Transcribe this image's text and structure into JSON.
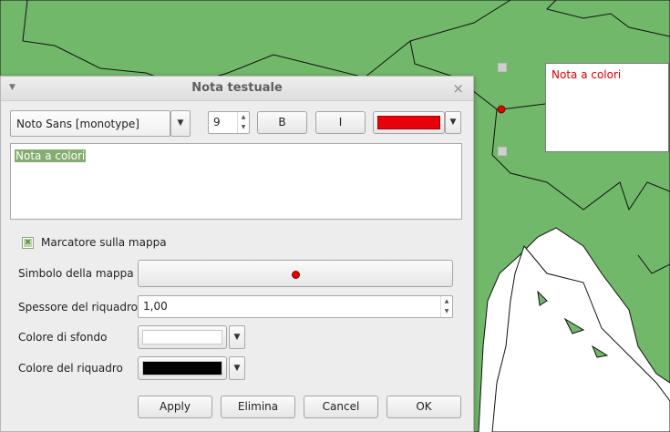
{
  "map": {
    "annotation_text": "Nota a colori",
    "land_color": "#72b86a",
    "background_color": "#ffffff",
    "marker_color": "#e00000"
  },
  "dialog": {
    "title": "Nota testuale",
    "menu_icon": "triangle-down-icon",
    "close_icon": "close-icon",
    "toolbar": {
      "font_family": "Noto Sans [monotype]",
      "font_size": "9",
      "bold_label": "B",
      "italic_label": "I",
      "text_color": "#e8000a"
    },
    "editor_text": "Nota a colori",
    "marker_checkbox": {
      "label": "Marcatore sulla mappa",
      "checked": true
    },
    "fields": {
      "symbol_label": "Simbolo della mappa",
      "frame_width_label": "Spessore del riquadro",
      "frame_width_value": "1,00",
      "background_color_label": "Colore di sfondo",
      "background_color": "#ffffff",
      "frame_color_label": "Colore del riquadro",
      "frame_color": "#000000"
    },
    "buttons": {
      "apply": "Apply",
      "delete": "Elimina",
      "cancel": "Cancel",
      "ok": "OK"
    }
  }
}
